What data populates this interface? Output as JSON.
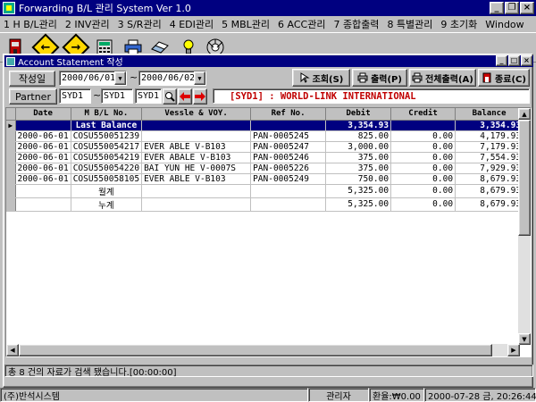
{
  "window": {
    "title": "Forwarding B/L 관리 System Ver 1.0"
  },
  "menu": [
    "1 H B/L관리",
    "2 INV관리",
    "3 S/R관리",
    "4 EDI관리",
    "5 MBL관리",
    "6 ACC관리",
    "7 종합출력",
    "8 특별관리",
    "9 초기화",
    "Window"
  ],
  "child": {
    "title": "Account Statement 작성"
  },
  "filters": {
    "date_label": "작성일",
    "date_from": "2000/06/01",
    "tilde": "~",
    "date_to": "2000/06/02",
    "partner_label": "Partner",
    "partner_from": "SYD1",
    "partner_to": "SYD1",
    "partner_code": "SYD1"
  },
  "buttons": {
    "search": "조회(S)",
    "print": "출력(P)",
    "print_all": "전체출력(A)",
    "close": "종료(C)"
  },
  "partner_info": "[SYD1] : WORLD-LINK INTERNATIONAL",
  "grid": {
    "columns": [
      "Date",
      "M B/L No.",
      "Vessle & VOY.",
      "Ref No.",
      "Debit",
      "Credit",
      "Balance"
    ],
    "rows": [
      {
        "date": "",
        "mbl": "Last Balance",
        "vessel": "",
        "ref": "",
        "debit": "3,354.93",
        "credit": "",
        "balance": "3,354.93",
        "selected": true
      },
      {
        "date": "2000-06-01",
        "mbl": "COSU550051239",
        "vessel": "",
        "ref": "PAN-0005245",
        "debit": "825.00",
        "credit": "0.00",
        "balance": "4,179.93"
      },
      {
        "date": "2000-06-01",
        "mbl": "COSU550054217",
        "vessel": "EVER ABLE V-B103",
        "ref": "PAN-0005247",
        "debit": "3,000.00",
        "credit": "0.00",
        "balance": "7,179.93"
      },
      {
        "date": "2000-06-01",
        "mbl": "COSU550054219",
        "vessel": "EVER ABALE V-B103",
        "ref": "PAN-0005246",
        "debit": "375.00",
        "credit": "0.00",
        "balance": "7,554.93"
      },
      {
        "date": "2000-06-01",
        "mbl": "COSU550054220",
        "vessel": "BAI YUN HE V-0007S",
        "ref": "PAN-0005226",
        "debit": "375.00",
        "credit": "0.00",
        "balance": "7,929.93"
      },
      {
        "date": "2000-06-01",
        "mbl": "COSU550058105",
        "vessel": "EVER ABLE V-B103",
        "ref": "PAN-0005249",
        "debit": "750.00",
        "credit": "0.00",
        "balance": "8,679.93"
      },
      {
        "date": "",
        "mbl": "월계",
        "vessel": "",
        "ref": "",
        "debit": "5,325.00",
        "credit": "0.00",
        "balance": "8,679.93"
      },
      {
        "date": "",
        "mbl": "누계",
        "vessel": "",
        "ref": "",
        "debit": "5,325.00",
        "credit": "0.00",
        "balance": "8,679.93"
      }
    ]
  },
  "message": "총 8 건의 자료가 검색 됐습니다.[00:00:00]",
  "status": {
    "company": "(주)반석시스템",
    "user": "관리자",
    "exchange": "환율:₩0.00",
    "datetime": "2000-07-28 금, 20:26:44"
  },
  "colors": {
    "titlebar": "#000080",
    "face": "#c0c0c0",
    "accent_red": "#c00000",
    "toolbar_yellow": "#ffd800"
  },
  "icons": [
    "exit-icon",
    "back-arrow-icon",
    "forward-arrow-icon",
    "calculator-icon",
    "printer-icon",
    "eraser-icon",
    "lightbulb-icon",
    "network-icon",
    "magnifier-icon",
    "left-red-arrow-icon",
    "right-red-arrow-icon"
  ]
}
